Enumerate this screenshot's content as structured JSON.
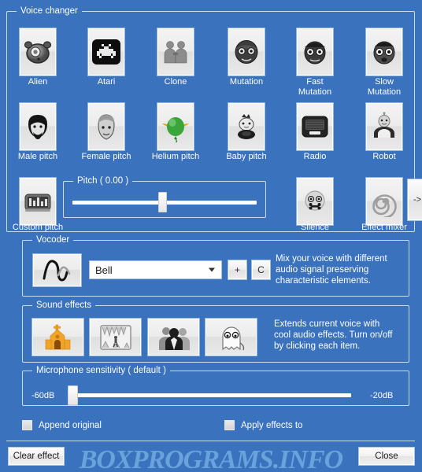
{
  "window": {
    "background_color": "#3a72bd",
    "watermark": "BOXPROGRAMS.INFO"
  },
  "voice_changer": {
    "legend": "Voice changer",
    "items": [
      {
        "label": "Alien",
        "icon": "alien-icon"
      },
      {
        "label": "Atari",
        "icon": "atari-invader-icon"
      },
      {
        "label": "Clone",
        "icon": "clone-twins-icon"
      },
      {
        "label": "Mutation",
        "icon": "mutation-face-icon"
      },
      {
        "label": "Fast\nMutation",
        "icon": "fast-mutation-face-icon"
      },
      {
        "label": "Slow\nMutation",
        "icon": "slow-mutation-face-icon"
      },
      {
        "label": "Male pitch",
        "icon": "male-face-icon"
      },
      {
        "label": "Female pitch",
        "icon": "female-face-icon"
      },
      {
        "label": "Helium pitch",
        "icon": "helium-balloon-icon"
      },
      {
        "label": "Baby pitch",
        "icon": "baby-icon"
      },
      {
        "label": "Radio",
        "icon": "radio-icon"
      },
      {
        "label": "Robot",
        "icon": "robot-icon"
      },
      {
        "label": "Custom pitch",
        "icon": "equalizer-icon"
      },
      {
        "label": "Silence",
        "icon": "silence-skull-icon"
      },
      {
        "label": "Effect mixer",
        "icon": "spiral-icon"
      }
    ],
    "pitch": {
      "legend": "Pitch ( 0.00 )",
      "value": 0.0,
      "min": -1,
      "max": 1,
      "thumb_percent": 48
    },
    "next_page_button": "->"
  },
  "vocoder": {
    "legend": "Vocoder",
    "icon": "waveform-icon",
    "selected": "Bell",
    "options": [
      "Bell"
    ],
    "add_button": "+",
    "clear_button": "C",
    "description": "Mix your voice with different\naudio signal preserving\ncharacteristic elements."
  },
  "sound_effects": {
    "legend": "Sound effects",
    "items": [
      {
        "icon": "church-icon"
      },
      {
        "icon": "cave-icon"
      },
      {
        "icon": "crowd-icon"
      },
      {
        "icon": "ghost-icon"
      }
    ],
    "description": "Extends current voice with\ncool audio effects. Turn on/off\nby clicking each item."
  },
  "microphone_sensitivity": {
    "legend": "Microphone sensitivity ( default )",
    "min_label": "-60dB",
    "max_label": "-20dB",
    "thumb_percent": 2
  },
  "checkboxes": [
    {
      "label": "Append original",
      "checked": false
    },
    {
      "label": "Apply effects to",
      "checked": false
    }
  ],
  "footer": {
    "clear_effect_label": "Clear effect",
    "close_label": "Close"
  }
}
